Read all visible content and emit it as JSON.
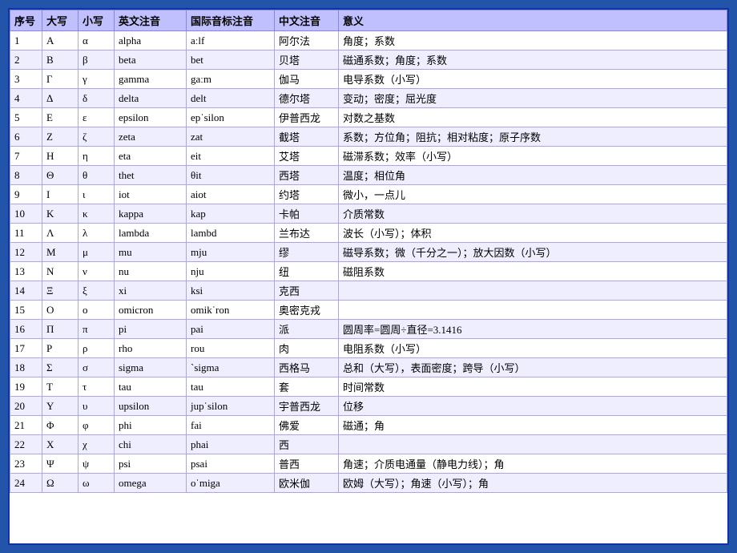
{
  "table": {
    "headers": [
      "序号",
      "大写",
      "小写",
      "英文注音",
      "国际音标注音",
      "中文注音",
      "意义"
    ],
    "rows": [
      {
        "seq": "1",
        "upper": "Α",
        "lower": "α",
        "en": "alpha",
        "ipa": "aːlf",
        "cn": "阿尔法",
        "meaning": "角度；系数"
      },
      {
        "seq": "2",
        "upper": "Β",
        "lower": "β",
        "en": "beta",
        "ipa": "bet",
        "cn": "贝塔",
        "meaning": "磁通系数；角度；系数"
      },
      {
        "seq": "3",
        "upper": "Γ",
        "lower": "γ",
        "en": "gamma",
        "ipa": "gaːm",
        "cn": "伽马",
        "meaning": "电导系数（小写）"
      },
      {
        "seq": "4",
        "upper": "Δ",
        "lower": "δ",
        "en": "delta",
        "ipa": "delt",
        "cn": "德尔塔",
        "meaning": "变动；密度；屈光度"
      },
      {
        "seq": "5",
        "upper": "Ε",
        "lower": "ε",
        "en": "epsilon",
        "ipa": "epˈsilon",
        "cn": "伊普西龙",
        "meaning": "对数之基数"
      },
      {
        "seq": "6",
        "upper": "Ζ",
        "lower": "ζ",
        "en": "zeta",
        "ipa": "zat",
        "cn": "截塔",
        "meaning": "系数；方位角；阻抗；相对粘度；原子序数"
      },
      {
        "seq": "7",
        "upper": "Η",
        "lower": "η",
        "en": "eta",
        "ipa": "eit",
        "cn": "艾塔",
        "meaning": "磁滞系数；效率（小写）"
      },
      {
        "seq": "8",
        "upper": "Θ",
        "lower": "θ",
        "en": "thet",
        "ipa": "θit",
        "cn": "西塔",
        "meaning": "温度；相位角"
      },
      {
        "seq": "9",
        "upper": "Ι",
        "lower": "ι",
        "en": "iot",
        "ipa": "aiot",
        "cn": "约塔",
        "meaning": "微小，一点儿"
      },
      {
        "seq": "10",
        "upper": "Κ",
        "lower": "κ",
        "en": "kappa",
        "ipa": "kap",
        "cn": "卡帕",
        "meaning": "介质常数"
      },
      {
        "seq": "11",
        "upper": "Λ",
        "lower": "λ",
        "en": "lambda",
        "ipa": "lambd",
        "cn": "兰布达",
        "meaning": "波长（小写）；体积"
      },
      {
        "seq": "12",
        "upper": "Μ",
        "lower": "μ",
        "en": "mu",
        "ipa": "mju",
        "cn": "缪",
        "meaning": "磁导系数；微（千分之一）；放大因数（小写）"
      },
      {
        "seq": "13",
        "upper": "Ν",
        "lower": "ν",
        "en": "nu",
        "ipa": "nju",
        "cn": "纽",
        "meaning": "磁阻系数"
      },
      {
        "seq": "14",
        "upper": "Ξ",
        "lower": "ξ",
        "en": "xi",
        "ipa": "ksi",
        "cn": "克西",
        "meaning": ""
      },
      {
        "seq": "15",
        "upper": "Ο",
        "lower": "ο",
        "en": "omicron",
        "ipa": "omikˈron",
        "cn": "奥密克戎",
        "meaning": ""
      },
      {
        "seq": "16",
        "upper": "Π",
        "lower": "π",
        "en": "pi",
        "ipa": "pai",
        "cn": "派",
        "meaning": "圆周率=圆周÷直径=3.1416"
      },
      {
        "seq": "17",
        "upper": "Ρ",
        "lower": "ρ",
        "en": "rho",
        "ipa": "rou",
        "cn": "肉",
        "meaning": "电阻系数（小写）"
      },
      {
        "seq": "18",
        "upper": "Σ",
        "lower": "σ",
        "en": "sigma",
        "ipa": "`sigma",
        "cn": "西格马",
        "meaning": "总和（大写），表面密度；跨导（小写）"
      },
      {
        "seq": "19",
        "upper": "Τ",
        "lower": "τ",
        "en": "tau",
        "ipa": "tau",
        "cn": "套",
        "meaning": "时间常数"
      },
      {
        "seq": "20",
        "upper": "Υ",
        "lower": "υ",
        "en": "upsilon",
        "ipa": "jupˈsilon",
        "cn": "宇普西龙",
        "meaning": "位移"
      },
      {
        "seq": "21",
        "upper": "Φ",
        "lower": "φ",
        "en": "phi",
        "ipa": "fai",
        "cn": "佛爱",
        "meaning": "磁通；角"
      },
      {
        "seq": "22",
        "upper": "Χ",
        "lower": "χ",
        "en": "chi",
        "ipa": "phai",
        "cn": "西",
        "meaning": ""
      },
      {
        "seq": "23",
        "upper": "Ψ",
        "lower": "ψ",
        "en": "psi",
        "ipa": "psai",
        "cn": "普西",
        "meaning": "角速；介质电通量（静电力线）；角"
      },
      {
        "seq": "24",
        "upper": "Ω",
        "lower": "ω",
        "en": "omega",
        "ipa": "oˈmiga",
        "cn": "欧米伽",
        "meaning": "欧姆（大写）；角速（小写）；角"
      }
    ]
  }
}
